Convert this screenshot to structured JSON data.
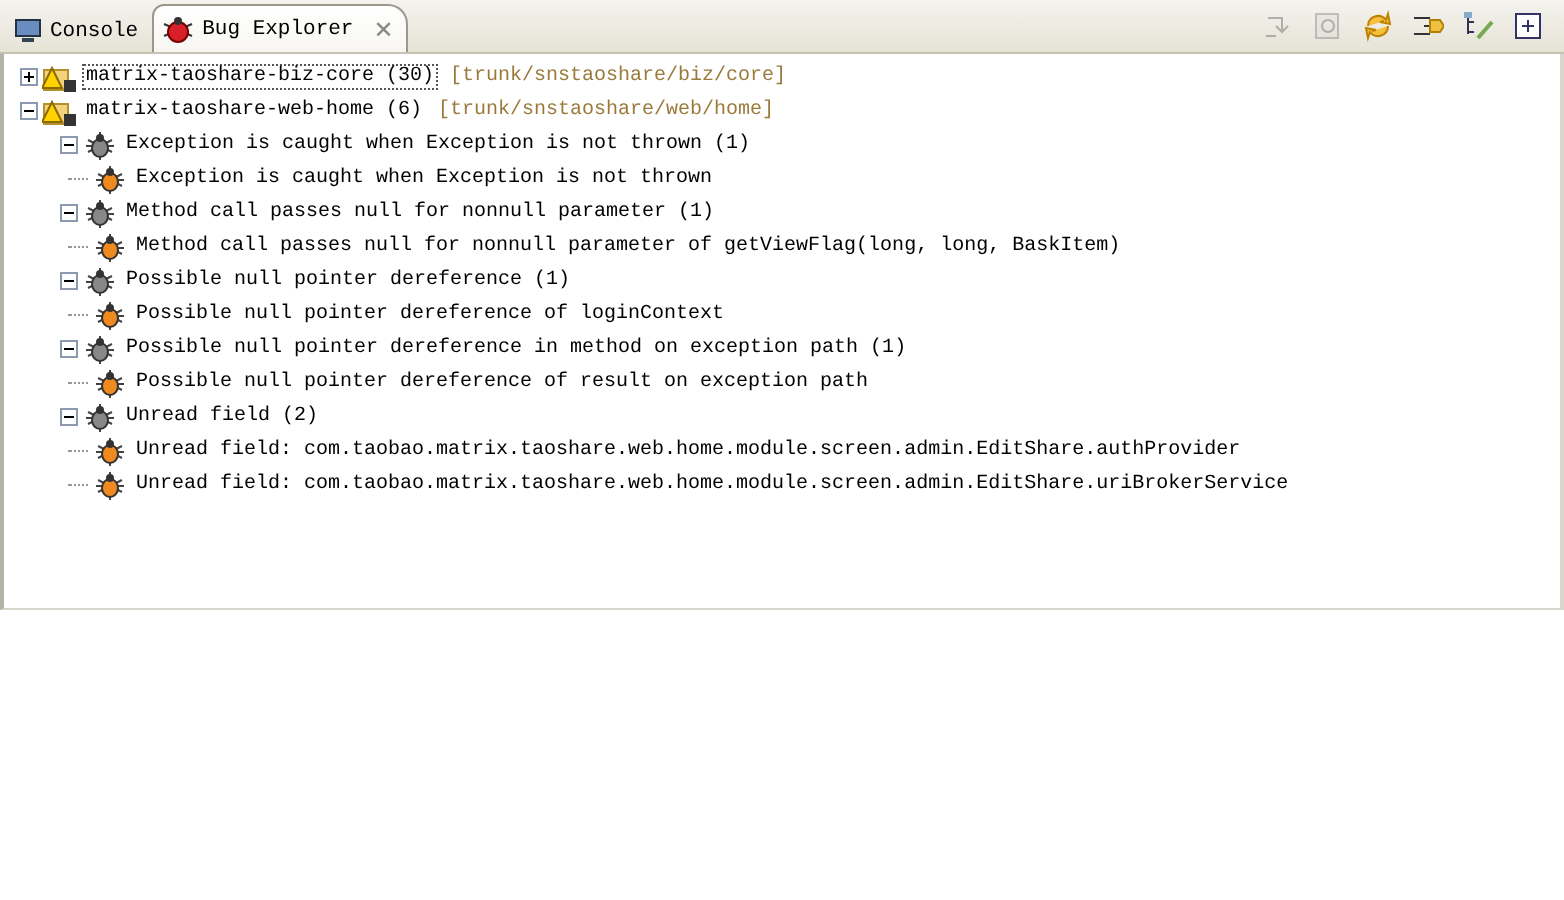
{
  "tabs": [
    {
      "label": "Console",
      "selected": false,
      "kind": "console"
    },
    {
      "label": "Bug Explorer",
      "selected": true,
      "kind": "bugs",
      "close": "✕"
    }
  ],
  "toolbar": [
    {
      "disabled": true
    },
    {
      "disabled": true
    },
    {
      "disabled": false
    },
    {
      "disabled": false
    },
    {
      "disabled": false
    },
    {
      "disabled": false
    }
  ],
  "projects": [
    {
      "name": "matrix-taoshare-biz-core (30)",
      "path": "[trunk/snstaoshare/biz/core]",
      "expanded": false,
      "focused": true
    },
    {
      "name": "matrix-taoshare-web-home (6)",
      "path": "[trunk/snstaoshare/web/home]",
      "expanded": true,
      "focused": false,
      "children": [
        {
          "label": "Exception is caught when Exception is not thrown (1)",
          "expanded": true,
          "children": [
            {
              "label": "Exception is caught when Exception is not thrown"
            }
          ]
        },
        {
          "label": "Method call passes null for nonnull parameter (1)",
          "expanded": true,
          "children": [
            {
              "label": "Method call passes null for nonnull parameter of getViewFlag(long, long, BaskItem)"
            }
          ]
        },
        {
          "label": "Possible null pointer dereference (1)",
          "expanded": true,
          "children": [
            {
              "label": "Possible null pointer dereference of loginContext"
            }
          ]
        },
        {
          "label": "Possible null pointer dereference in method on exception path (1)",
          "expanded": true,
          "children": [
            {
              "label": "Possible null pointer dereference of result on exception path"
            }
          ]
        },
        {
          "label": "Unread field (2)",
          "expanded": true,
          "children": [
            {
              "label": "Unread field: com.taobao.matrix.taoshare.web.home.module.screen.admin.EditShare.authProvider"
            },
            {
              "label": "Unread field: com.taobao.matrix.taoshare.web.home.module.screen.admin.EditShare.uriBrokerService"
            }
          ]
        }
      ]
    }
  ]
}
